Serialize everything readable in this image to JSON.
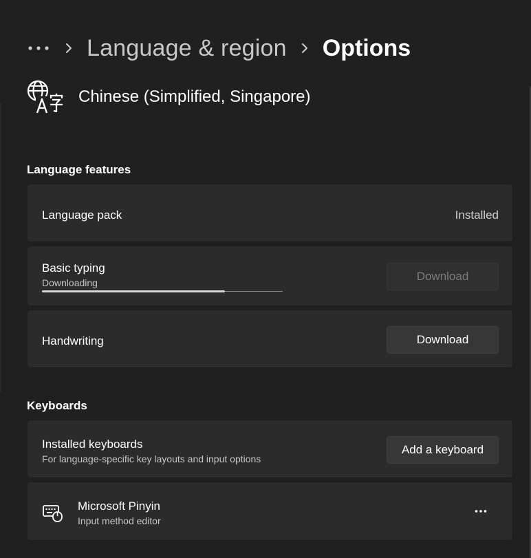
{
  "breadcrumb": {
    "more_icon": "more-horizontal-icon",
    "separator_icon": "chevron-right-icon",
    "parent": "Language & region",
    "current": "Options"
  },
  "language": {
    "icon": "language-icon",
    "name": "Chinese (Simplified, Singapore)"
  },
  "language_features": {
    "title": "Language features",
    "items": [
      {
        "title": "Language pack",
        "status": "Installed"
      },
      {
        "title": "Basic typing",
        "subtitle": "Downloading",
        "progress_percent": 76,
        "button_label": "Download",
        "button_enabled": false
      },
      {
        "title": "Handwriting",
        "button_label": "Download",
        "button_enabled": true
      }
    ]
  },
  "keyboards": {
    "title": "Keyboards",
    "installed": {
      "title": "Installed keyboards",
      "subtitle": "For language-specific key layouts and input options",
      "button_label": "Add a keyboard"
    },
    "items": [
      {
        "icon": "keyboard-icon",
        "name": "Microsoft Pinyin",
        "description": "Input method editor",
        "more_icon": "more-horizontal-icon"
      }
    ]
  },
  "colors": {
    "background": "#202020",
    "card": "#2b2b2b",
    "button": "#373737",
    "button_disabled_text": "#7d7d7d",
    "progress_fill": "#d8d8d8"
  }
}
